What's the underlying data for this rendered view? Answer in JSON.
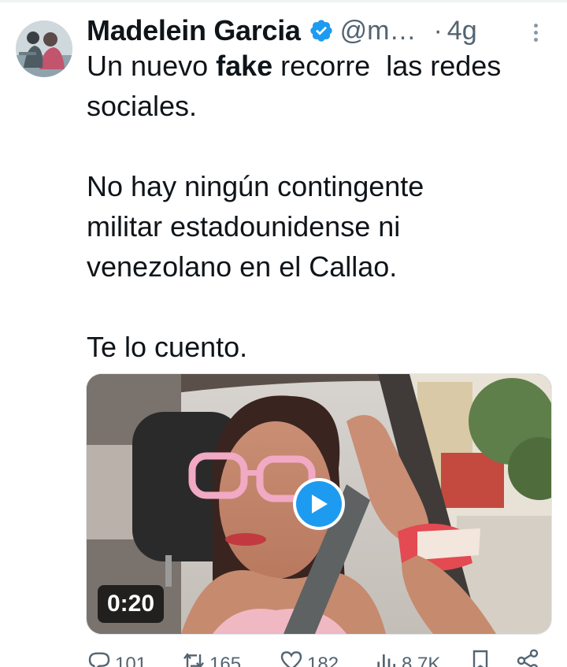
{
  "tweet": {
    "author_name": "Madelein Garcia",
    "handle": "@m…",
    "separator": "·",
    "time": "4g",
    "text": {
      "line1_pre": "Un nuevo ",
      "line1_bold": "fake",
      "line1_post": " recorre  las redes",
      "line2": "sociales.",
      "line3": "No hay ningún contingente",
      "line4": "militar estadounidense ni",
      "line5": "venezolano en el Callao.",
      "line6": "Te lo cuento."
    },
    "video": {
      "duration": "0:20"
    },
    "actions": {
      "replies": "101",
      "retweets": "165",
      "likes": "182",
      "views": "8,7K"
    }
  },
  "colors": {
    "accent": "#1d9bf0",
    "text": "#0f1419",
    "muted": "#536471"
  },
  "icons": [
    "verified-badge-icon",
    "more-options-icon",
    "play-icon",
    "reply-icon",
    "retweet-icon",
    "like-icon",
    "views-icon",
    "bookmark-icon",
    "share-icon"
  ]
}
